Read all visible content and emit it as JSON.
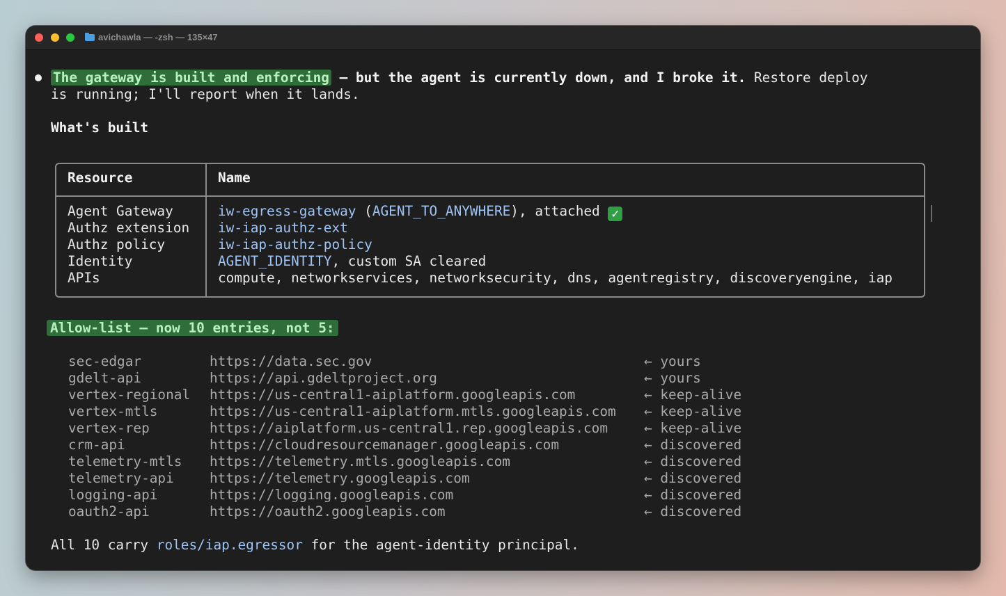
{
  "window": {
    "title": "avichawla — -zsh — 135×47"
  },
  "intro": {
    "highlight": "The gateway is built and enforcing",
    "bold_rest": " — but the agent is currently down, and I broke it.",
    "normal_rest": " Restore deploy",
    "line2": "is running; I'll report when it lands."
  },
  "whats_built_heading": "What's built",
  "table": {
    "headers": [
      "Resource",
      "Name"
    ],
    "rows": [
      {
        "resource": "Agent Gateway",
        "name_blue": "iw-egress-gateway",
        "name_mid1": " (",
        "name_blue2": "AGENT_TO_ANYWHERE",
        "name_mid2": "), attached ",
        "check": "✓"
      },
      {
        "resource": "Authz extension",
        "name_blue": "iw-iap-authz-ext"
      },
      {
        "resource": "Authz policy",
        "name_blue": "iw-iap-authz-policy"
      },
      {
        "resource": "Identity",
        "name_blue": "AGENT_IDENTITY",
        "name_rest": ", custom SA cleared"
      },
      {
        "resource": "APIs",
        "name_plain": "compute, networkservices, networksecurity, dns, agentregistry, discoveryengine, iap"
      }
    ]
  },
  "allowlist": {
    "heading": "Allow-list — now 10 entries, not 5:",
    "arrow": "←",
    "entries": [
      {
        "name": "sec-edgar",
        "url": "https://data.sec.gov",
        "note": "yours"
      },
      {
        "name": "gdelt-api",
        "url": "https://api.gdeltproject.org",
        "note": "yours"
      },
      {
        "name": "vertex-regional",
        "url": "https://us-central1-aiplatform.googleapis.com",
        "note": "keep-alive"
      },
      {
        "name": "vertex-mtls",
        "url": "https://us-central1-aiplatform.mtls.googleapis.com",
        "note": "keep-alive"
      },
      {
        "name": "vertex-rep",
        "url": "https://aiplatform.us-central1.rep.googleapis.com",
        "note": "keep-alive"
      },
      {
        "name": "crm-api",
        "url": "https://cloudresourcemanager.googleapis.com",
        "note": "discovered"
      },
      {
        "name": "telemetry-mtls",
        "url": "https://telemetry.mtls.googleapis.com",
        "note": "discovered"
      },
      {
        "name": "telemetry-api",
        "url": "https://telemetry.googleapis.com",
        "note": "discovered"
      },
      {
        "name": "logging-api",
        "url": "https://logging.googleapis.com",
        "note": "discovered"
      },
      {
        "name": "oauth2-api",
        "url": "https://oauth2.googleapis.com",
        "note": "discovered"
      }
    ]
  },
  "footer": {
    "before": "All 10 carry ",
    "role": "roles/iap.egressor",
    "after": " for the agent-identity principal."
  },
  "colors": {
    "highlight_bg": "#2f6d3a",
    "link": "#9ec4f5",
    "terminal_bg": "#1e1e1e"
  }
}
